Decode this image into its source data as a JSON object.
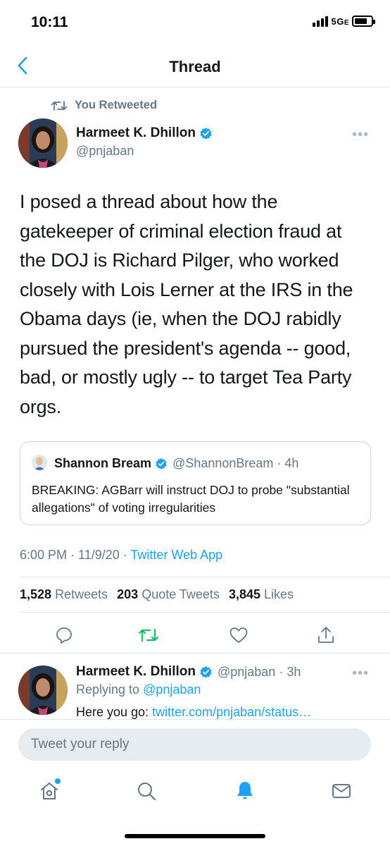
{
  "status_bar": {
    "time": "10:11",
    "network": "5G",
    "network_suffix": "E"
  },
  "nav": {
    "title": "Thread",
    "back_icon": "chevron-left-icon"
  },
  "tweet": {
    "retweeted_label": "You Retweeted",
    "author_name": "Harmeet K. Dhillon",
    "author_handle": "@pnjaban",
    "text": "I posed a thread about how the gatekeeper of criminal election fraud at the DOJ is Richard Pilger, who worked closely with Lois Lerner at the IRS in the Obama days (ie, when the DOJ rabidly pursued the president's agenda -- good, bad, or mostly ugly -- to target Tea Party orgs.",
    "more_icon": "•••",
    "timestamp": "6:00 PM · 11/9/20 · ",
    "source": "Twitter Web App",
    "stats": {
      "retweets_count": "1,528",
      "retweets_label": "Retweets",
      "quotes_count": "203",
      "quotes_label": "Quote Tweets",
      "likes_count": "3,845",
      "likes_label": "Likes"
    }
  },
  "quote": {
    "name": "Shannon Bream",
    "handle": "@ShannonBream",
    "time": "· 4h",
    "text": "BREAKING:  AGBarr will instruct DOJ to probe \"substantial allegations\" of voting irregularities"
  },
  "reply": {
    "name": "Harmeet K. Dhillon",
    "handle": "@pnjaban",
    "time": "· 3h",
    "replying_prefix": "Replying to ",
    "replying_to": "@pnjaban",
    "text_prefix": "Here you go: ",
    "link": "twitter.com/pnjaban/status…"
  },
  "composer": {
    "placeholder": "Tweet your reply"
  },
  "colors": {
    "accent": "#1da1f2",
    "retweet_green": "#17bf63",
    "muted": "#657786"
  }
}
